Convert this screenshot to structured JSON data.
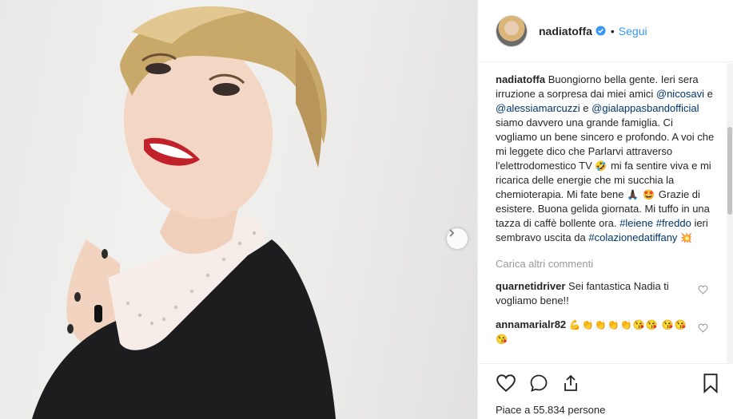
{
  "header": {
    "username": "nadiatoffa",
    "separator": "•",
    "follow_label": "Segui"
  },
  "caption": {
    "username": "nadiatoffa",
    "text_1": "Buongiorno bella gente. Ieri sera irruzione a sorpresa dai miei amici",
    "mention_1": "@nicosavi",
    "and_1": "e",
    "mention_2": "@alessiamarcuzzi",
    "and_2": "e",
    "mention_3": "@gialappasbandofficial",
    "text_2": "siamo davvero una grande famiglia. Ci vogliamo un bene sincero e profondo. A voi che mi leggete dico che Parlarvi attraverso l'elettrodomestico TV",
    "emoji_1": "🤣",
    "text_3": "mi fa sentire viva e mi ricarica delle energie che mi succhia la chemioterapia. Mi fate bene",
    "emoji_2": "🙏🏿 🤩",
    "text_4": "Grazie di esistere. Buona gelida giornata. Mi tuffo in una tazza di caffè bollente ora.",
    "hashtag_1": "#leiene",
    "hashtag_2": "#freddo",
    "text_5": "ieri sembravo uscita da",
    "hashtag_3": "#colazionedatiffany",
    "emoji_3": "💥"
  },
  "load_more_label": "Carica altri commenti",
  "comments": [
    {
      "username": "quarnetidriver",
      "text": "Sei fantastica Nadia ti vogliamo bene!!"
    },
    {
      "username": "annamarialr82",
      "text": "💪👏👏👏👏😘😘 😘😘😘"
    }
  ],
  "likes_text": "Piace a 55.834 persone",
  "icons": {
    "like": "heart-icon",
    "comment": "comment-icon",
    "share": "share-icon",
    "save": "bookmark-icon",
    "verified": "verified-badge-icon",
    "next": "chevron-right-icon"
  },
  "colors": {
    "link": "#003569",
    "follow": "#3897f0",
    "verified": "#3897f0",
    "muted": "#999999"
  }
}
